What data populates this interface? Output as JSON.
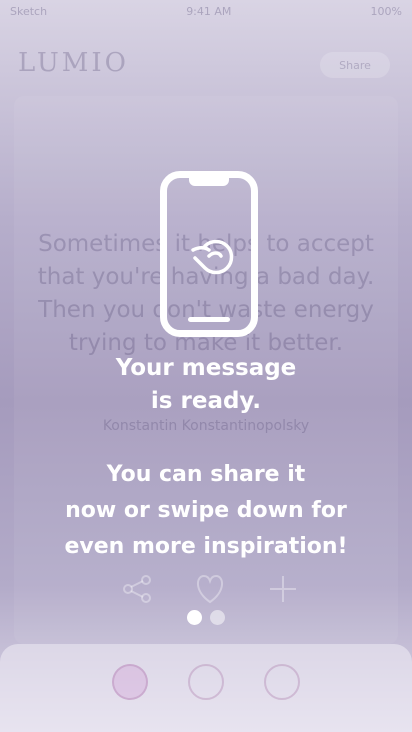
{
  "status_bar": {
    "carrier": "Sketch",
    "time": "9:41 AM",
    "battery": "100%"
  },
  "app": {
    "logo": "LUMIO",
    "pill_label": "Share",
    "quote": "Sometimes it helps to accept that you're having a bad day. Then you don't waste energy trying to make it better.",
    "author": "Konstantin Konstantinopolsky"
  },
  "overlay": {
    "title_line1": "Your message",
    "title_line2": "is ready.",
    "text_line1": "You can share it",
    "text_line2": "now or swipe down for",
    "text_line3": "even more inspiration!",
    "pages_total": 2,
    "page_current": 1
  },
  "icons": [
    "phone-icon",
    "hand-swipe-icon",
    "share-icon",
    "heart-icon",
    "plus-icon",
    "home-icon",
    "pen-icon",
    "edit-icon"
  ],
  "colors": {
    "overlay_text": "#ffffff",
    "accent": "#c078c0"
  }
}
